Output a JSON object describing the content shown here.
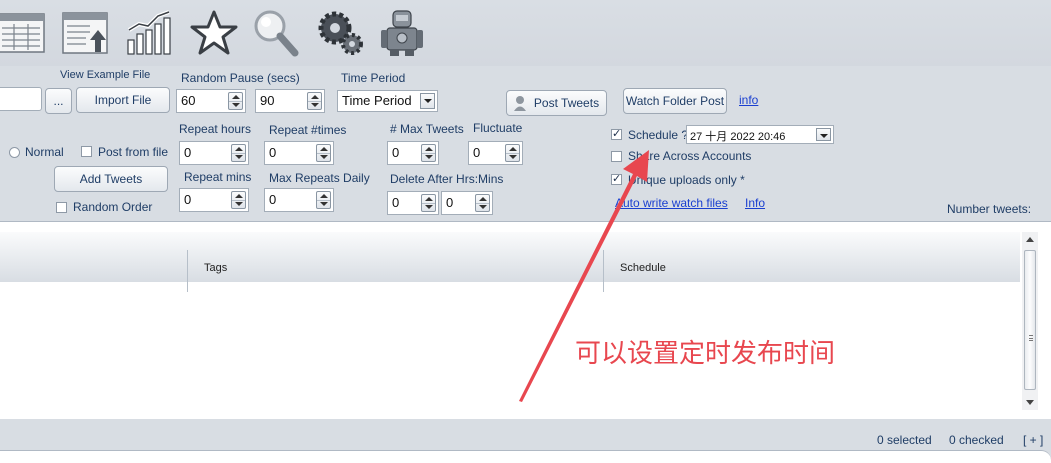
{
  "toolbar": {
    "icons": [
      "grid-sheet-icon",
      "upload-sheet-icon",
      "chart-icon",
      "star-icon",
      "magnifier-icon",
      "gears-icon",
      "robot-icon"
    ]
  },
  "form": {
    "view_example_file": "View Example File",
    "ellipsis": "...",
    "import_file": "Import File",
    "random_pause_label": "Random Pause (secs)",
    "pause_min": "60",
    "pause_max": "90",
    "time_period_label": "Time Period",
    "time_period_value": "Time Period",
    "post_tweets": "Post Tweets",
    "watch_folder_post": "Watch Folder Post",
    "info_link": "info",
    "repeat_hours_label": "Repeat hours",
    "repeat_hours_value": "0",
    "repeat_times_label": "Repeat #times",
    "repeat_times_value": "0",
    "max_tweets_label": "# Max Tweets",
    "max_tweets_value": "0",
    "fluctuate_label": "Fluctuate",
    "fluctuate_value": "0",
    "schedule_label": "Schedule ?",
    "schedule_value": "27  十月  2022 20:46",
    "normal_label": "Normal",
    "post_from_file_label": "Post from file",
    "share_across_label": "Share Across Accounts",
    "add_tweets": "Add Tweets",
    "repeat_mins_label": "Repeat mins",
    "repeat_mins_value": "0",
    "max_repeats_label": "Max Repeats Daily",
    "max_repeats_value": "0",
    "delete_after_label": "Delete After Hrs:Mins",
    "delete_hrs_value": "0",
    "delete_mins_value": "0",
    "unique_uploads_label": "Unique uploads only *",
    "random_order_label": "Random Order",
    "auto_write_link": "Auto write watch files",
    "info_link2": "Info",
    "number_tweets_label": "Number tweets:"
  },
  "grid": {
    "columns": [
      "Tags",
      "Schedule"
    ]
  },
  "status": {
    "selected": "0 selected",
    "checked": "0 checked",
    "expand": "[ + ]"
  },
  "annotation": {
    "text": "可以设置定时发布时间",
    "color": "#e8474f"
  }
}
